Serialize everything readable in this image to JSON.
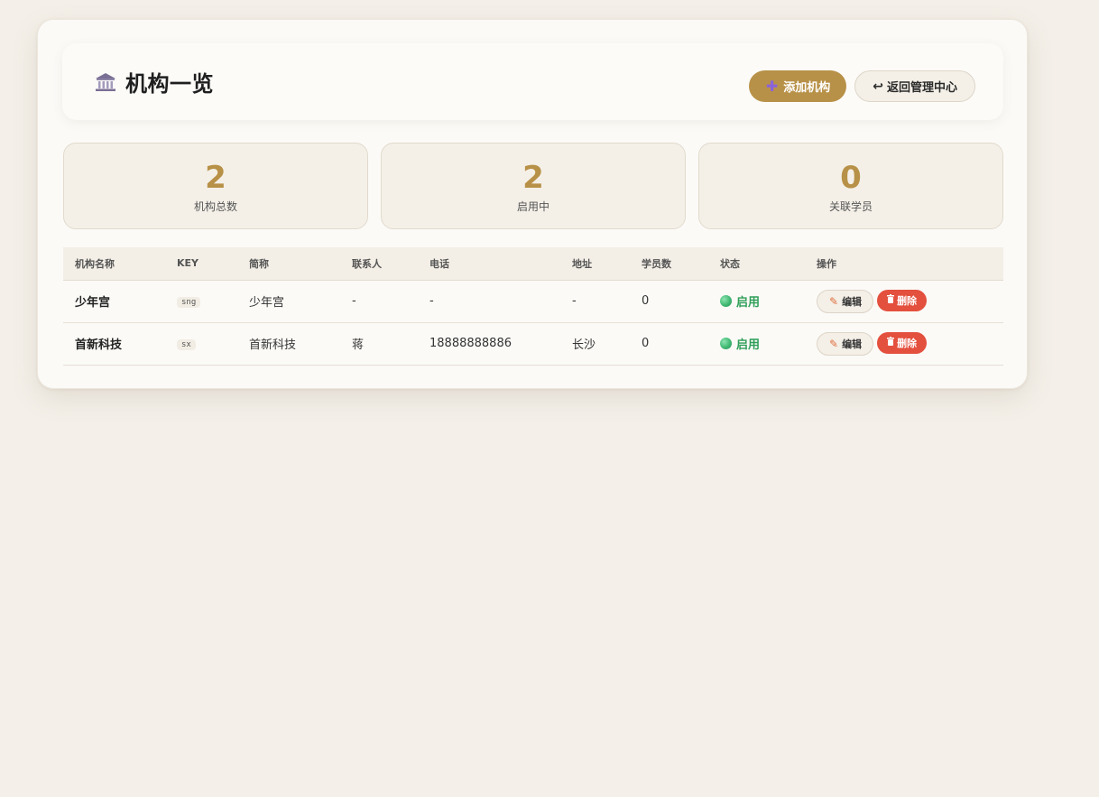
{
  "header": {
    "title": "机构一览",
    "title_icon": "bank-icon",
    "add_button": "添加机构",
    "add_icon": "plus-icon",
    "back_button": "返回管理中心",
    "back_icon": "return-arrow-icon"
  },
  "stats": [
    {
      "value": "2",
      "label": "机构总数"
    },
    {
      "value": "2",
      "label": "启用中"
    },
    {
      "value": "0",
      "label": "关联学员"
    }
  ],
  "table": {
    "columns": [
      "机构名称",
      "KEY",
      "简称",
      "联系人",
      "电话",
      "地址",
      "学员数",
      "状态",
      "操作"
    ],
    "rows": [
      {
        "name": "少年宫",
        "key": "sng",
        "short": "少年宫",
        "contact": "-",
        "phone": "-",
        "address": "-",
        "students": "0",
        "status": "启用",
        "edit": "编辑",
        "delete": "删除"
      },
      {
        "name": "首新科技",
        "key": "sx",
        "short": "首新科技",
        "contact": "蒋",
        "phone": "18888888886",
        "address": "长沙",
        "students": "0",
        "status": "启用",
        "edit": "编辑",
        "delete": "删除"
      }
    ]
  },
  "colors": {
    "accent": "#b89148",
    "status_active": "#2e9e58",
    "danger": "#e4503e",
    "background": "#f4f0e9"
  }
}
